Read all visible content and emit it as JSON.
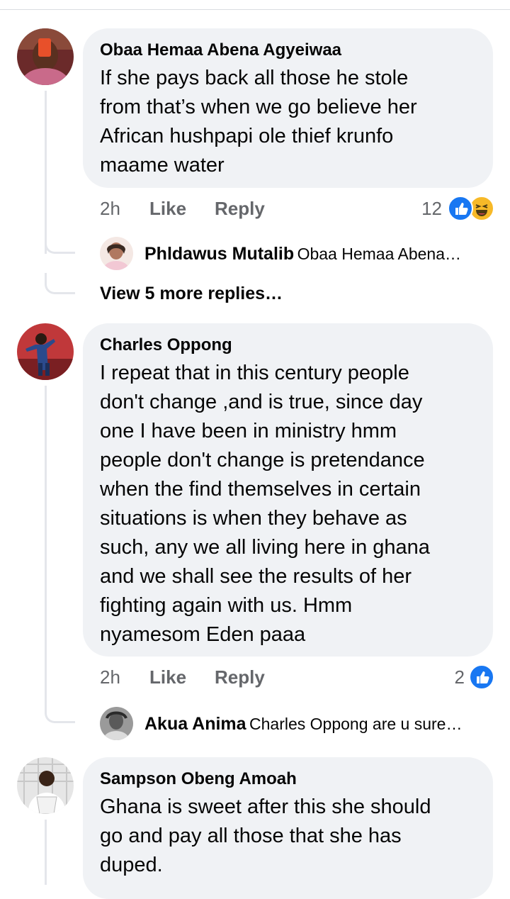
{
  "comments": [
    {
      "author": "Obaa Hemaa Abena Agyeiwaa",
      "text": "If she pays back all those he stole\nfrom that’s when we go believe her\nAfrican hushpapi ole thief krunfo\nmaame water",
      "time": "2h",
      "like_label": "Like",
      "reply_label": "Reply",
      "reaction_count": "12",
      "reactions": [
        "like-icon",
        "haha-icon"
      ],
      "reply_preview": {
        "author": "Phldawus Mutalib",
        "snippet": "Obaa Hemaa Abena…"
      },
      "view_more": "View 5 more replies…"
    },
    {
      "author": "Charles Oppong",
      "text": "I repeat that in this century people\ndon't change ,and is true, since day\none I have been in ministry hmm\npeople don't change is pretendance\nwhen the find themselves in certain\nsituations is when they behave as\nsuch, any we all living here in ghana\nand we shall see the results of her\nfighting again with us. Hmm\nnyamesom Eden paaa",
      "time": "2h",
      "like_label": "Like",
      "reply_label": "Reply",
      "reaction_count": "2",
      "reactions": [
        "like-icon"
      ],
      "reply_preview": {
        "author": "Akua Anima",
        "snippet": "Charles Oppong are u sure…"
      }
    },
    {
      "author": "Sampson Obeng Amoah",
      "text": "Ghana is sweet after this she should\ngo and pay all those that she has\nduped."
    }
  ],
  "colors": {
    "bubble": "#f0f2f5",
    "like_blue": "#1877f2",
    "haha_yellow": "#f7b928",
    "meta_gray": "#65676b"
  }
}
